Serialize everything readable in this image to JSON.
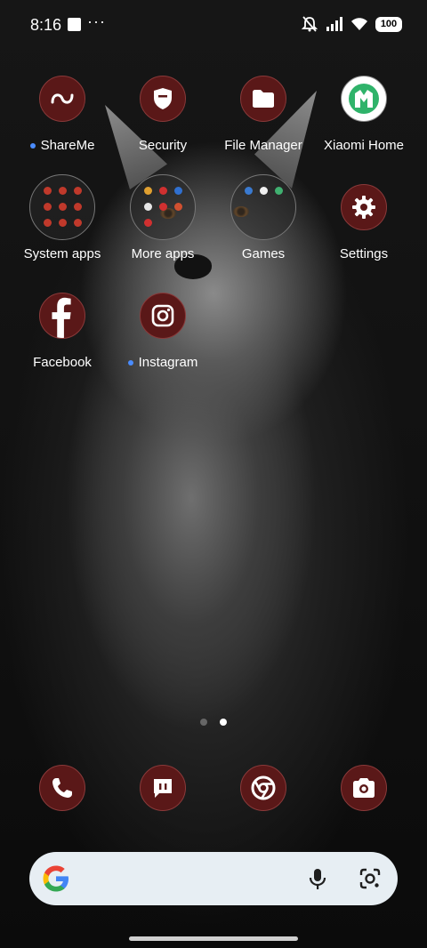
{
  "status_bar": {
    "time": "8:16",
    "dots": "···",
    "battery": "100"
  },
  "apps": [
    {
      "label": "ShareMe",
      "icon": "shareme-icon",
      "new": true
    },
    {
      "label": "Security",
      "icon": "security-shield-icon",
      "new": false
    },
    {
      "label": "File Manager",
      "icon": "folder-icon",
      "new": false
    },
    {
      "label": "Xiaomi Home",
      "icon": "xiaomi-home-icon",
      "new": false
    },
    {
      "label": "System apps",
      "icon": "folder-icon",
      "new": false
    },
    {
      "label": "More apps",
      "icon": "folder-icon",
      "new": false
    },
    {
      "label": "Games",
      "icon": "folder-icon",
      "new": false
    },
    {
      "label": "Settings",
      "icon": "gear-icon",
      "new": false
    },
    {
      "label": "Facebook",
      "icon": "facebook-icon",
      "new": false
    },
    {
      "label": "Instagram",
      "icon": "instagram-icon",
      "new": true
    }
  ],
  "dock": [
    {
      "name": "phone",
      "icon": "phone-icon"
    },
    {
      "name": "messages",
      "icon": "message-icon"
    },
    {
      "name": "chrome",
      "icon": "chrome-icon"
    },
    {
      "name": "camera",
      "icon": "camera-icon"
    }
  ],
  "page_indicator": {
    "total": 2,
    "active": 2
  },
  "search": {
    "mic": "mic-icon",
    "lens": "lens-icon"
  },
  "colors": {
    "icon_bg": "#5a1818",
    "accent_dot": "#4a8cff",
    "search_bg": "#e7eef3"
  }
}
